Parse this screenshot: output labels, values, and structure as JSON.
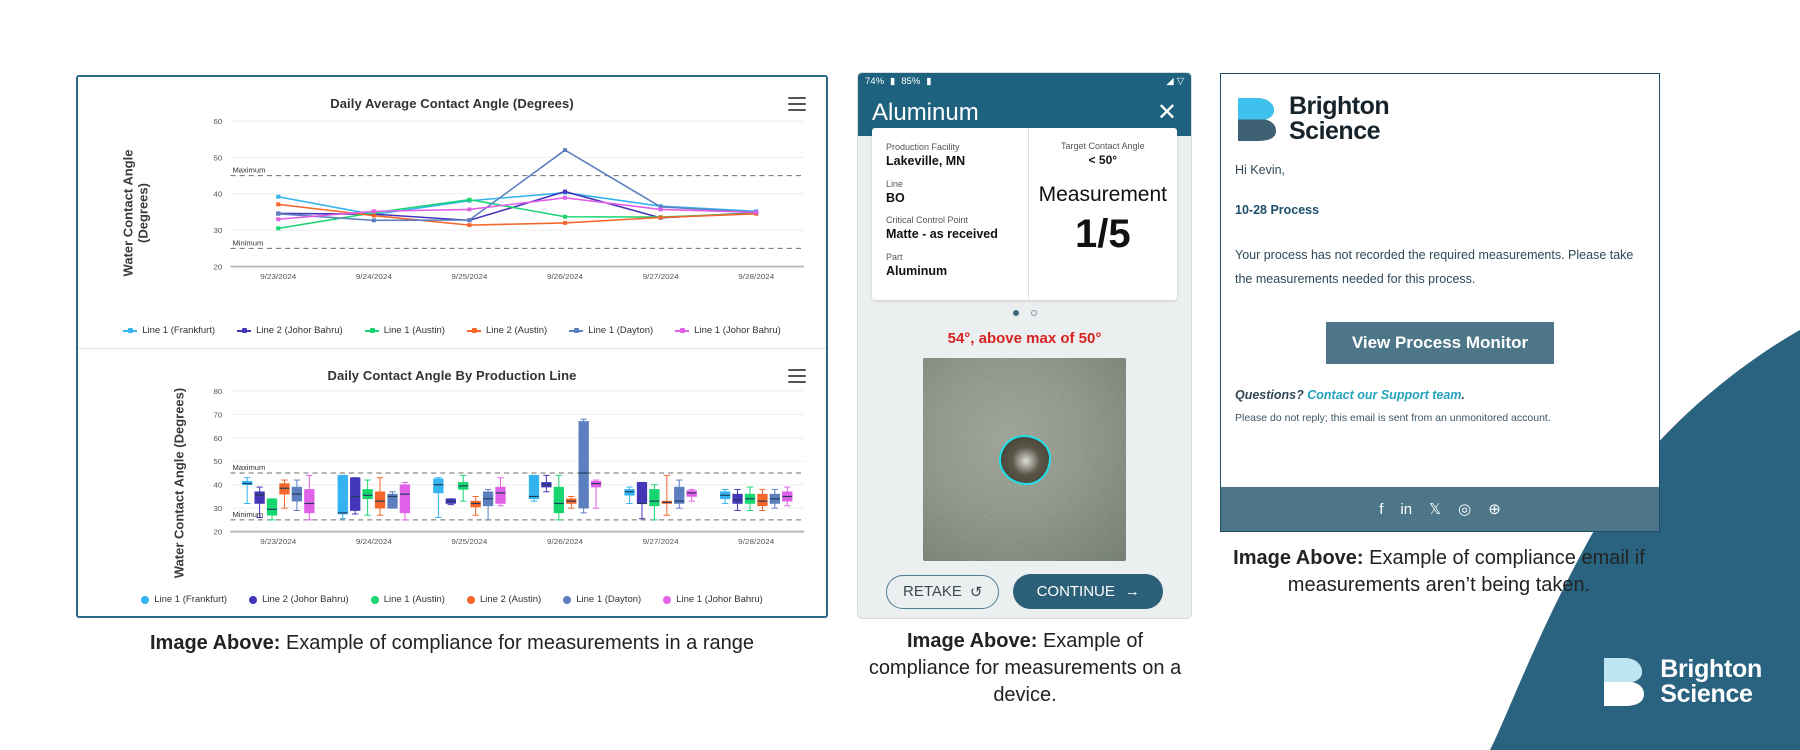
{
  "captions": {
    "left_bold": "Image Above:",
    "left_text": " Example of compliance for measurements in a range",
    "mid_bold": "Image Above:",
    "mid_text": " Example of compliance for measurements on a device.",
    "right_bold": "Image Above:",
    "right_text": " Example of compliance email if measurements aren’t being taken."
  },
  "brand": {
    "line1": "Brighton",
    "line2": "Science"
  },
  "chart_data": [
    {
      "type": "line",
      "title": "Daily Average Contact Angle (Degrees)",
      "xlabel": "",
      "ylabel": "Water Contact Angle\n(Degrees)",
      "ylabel_l1": "Water Contact Angle",
      "ylabel_l2": "(Degrees)",
      "ylim": [
        20,
        60
      ],
      "yticks": [
        20,
        30,
        40,
        50,
        60
      ],
      "categories": [
        "9/23/2024",
        "9/24/2024",
        "9/25/2024",
        "9/26/2024",
        "9/27/2024",
        "9/28/2024"
      ],
      "limits": [
        {
          "label": "Maximum",
          "value": 45
        },
        {
          "label": "Minimum",
          "value": 25
        }
      ],
      "grid": true,
      "legend_position": "bottom",
      "series": [
        {
          "name": "Line 1 (Frankfurt)",
          "color": "#33b4ef",
          "values": [
            39.2,
            34.3,
            38.1,
            40.3,
            36.6,
            35.2
          ]
        },
        {
          "name": "Line 2 (Johor Bahru)",
          "color": "#4436b8",
          "values": [
            34.6,
            34.4,
            32.7,
            40.6,
            33.4,
            34.8
          ]
        },
        {
          "name": "Line 1 (Austin)",
          "color": "#18d66f",
          "values": [
            30.5,
            34.8,
            38.4,
            33.7,
            33.6,
            34.6
          ]
        },
        {
          "name": "Line 2 (Austin)",
          "color": "#f4662a",
          "values": [
            37.1,
            34.0,
            31.4,
            32.0,
            33.5,
            34.5
          ]
        },
        {
          "name": "Line 1 (Dayton)",
          "color": "#5c7fc0",
          "values": [
            34.5,
            32.7,
            32.8,
            52.0,
            36.4,
            34.9
          ]
        },
        {
          "name": "Line 1 (Johor Bahru)",
          "color": "#e060e8",
          "values": [
            33.0,
            35.2,
            35.7,
            38.9,
            35.7,
            34.9
          ]
        }
      ]
    },
    {
      "type": "box",
      "title": "Daily Contact Angle By Production Line",
      "xlabel": "",
      "ylabel": "Water Contact Angle (Degrees)",
      "ylim": [
        20,
        80
      ],
      "yticks": [
        20,
        30,
        40,
        50,
        60,
        70,
        80
      ],
      "categories": [
        "9/23/2024",
        "9/24/2024",
        "9/25/2024",
        "9/26/2024",
        "9/27/2024",
        "9/28/2024"
      ],
      "limits": [
        {
          "label": "Maximum",
          "value": 45
        },
        {
          "label": "Minimum",
          "value": 25
        }
      ],
      "grid": true,
      "legend_position": "bottom",
      "series": [
        {
          "name": "Line 1 (Frankfurt)",
          "color": "#33b4ef",
          "boxes": [
            {
              "low": 32,
              "q1": 40,
              "med": 40.5,
              "q3": 41.5,
              "high": 43
            },
            {
              "low": 25.5,
              "q1": 27.5,
              "med": 28,
              "q3": 44,
              "high": 44
            },
            {
              "low": 26,
              "q1": 36.5,
              "med": 40,
              "q3": 42.5,
              "high": 43
            },
            {
              "low": 33,
              "q1": 34,
              "med": 35,
              "q3": 44,
              "high": 44
            },
            {
              "low": 32,
              "q1": 35.5,
              "med": 37,
              "q3": 38,
              "high": 39
            },
            {
              "low": 32,
              "q1": 34,
              "med": 35.5,
              "q3": 37,
              "high": 38
            }
          ]
        },
        {
          "name": "Line 2 (Johor Bahru)",
          "color": "#4436b8",
          "boxes": [
            {
              "low": 26,
              "q1": 32,
              "med": 35.5,
              "q3": 37,
              "high": 39
            },
            {
              "low": 27.5,
              "q1": 29,
              "med": 35,
              "q3": 43,
              "high": 43
            },
            {
              "low": 31.5,
              "q1": 32,
              "med": 33,
              "q3": 34,
              "high": 34
            },
            {
              "low": 37,
              "q1": 39,
              "med": 40,
              "q3": 41,
              "high": 44
            },
            {
              "low": 25.5,
              "q1": 32,
              "med": 32,
              "q3": 41,
              "high": 41
            },
            {
              "low": 29,
              "q1": 32,
              "med": 33.5,
              "q3": 36,
              "high": 38
            }
          ]
        },
        {
          "name": "Line 1 (Austin)",
          "color": "#18d66f",
          "boxes": [
            {
              "low": 25,
              "q1": 27,
              "med": 29.5,
              "q3": 34,
              "high": 34
            },
            {
              "low": 27,
              "q1": 34,
              "med": 35.5,
              "q3": 38,
              "high": 42
            },
            {
              "low": 33,
              "q1": 38,
              "med": 39.5,
              "q3": 41,
              "high": 44
            },
            {
              "low": 25,
              "q1": 28,
              "med": 32,
              "q3": 39,
              "high": 44
            },
            {
              "low": 25,
              "q1": 31,
              "med": 33,
              "q3": 38,
              "high": 40
            },
            {
              "low": 29,
              "q1": 32,
              "med": 34,
              "q3": 36,
              "high": 39
            }
          ]
        },
        {
          "name": "Line 2 (Austin)",
          "color": "#f4662a",
          "boxes": [
            {
              "low": 30,
              "q1": 36,
              "med": 38.5,
              "q3": 40.5,
              "high": 42
            },
            {
              "low": 27,
              "q1": 30,
              "med": 33,
              "q3": 37,
              "high": 43
            },
            {
              "low": 27,
              "q1": 30.5,
              "med": 32,
              "q3": 33,
              "high": 35
            },
            {
              "low": 30,
              "q1": 32,
              "med": 33,
              "q3": 34,
              "high": 35
            },
            {
              "low": 27,
              "q1": 32,
              "med": 32.5,
              "q3": 33,
              "high": 44
            },
            {
              "low": 29,
              "q1": 31,
              "med": 33,
              "q3": 36,
              "high": 38
            }
          ]
        },
        {
          "name": "Line 1 (Dayton)",
          "color": "#5c7fc0",
          "boxes": [
            {
              "low": 29,
              "q1": 33,
              "med": 36,
              "q3": 39,
              "high": 42
            },
            {
              "low": 30,
              "q1": 30,
              "med": 35,
              "q3": 36,
              "high": 37
            },
            {
              "low": 25,
              "q1": 31,
              "med": 34,
              "q3": 37,
              "high": 38
            },
            {
              "low": 28,
              "q1": 30,
              "med": 45,
              "q3": 67,
              "high": 68
            },
            {
              "low": 30,
              "q1": 32,
              "med": 33,
              "q3": 39,
              "high": 42
            },
            {
              "low": 30,
              "q1": 32,
              "med": 34,
              "q3": 36,
              "high": 38
            }
          ]
        },
        {
          "name": "Line 1 (Johor Bahru)",
          "color": "#e060e8",
          "boxes": [
            {
              "low": 25,
              "q1": 28,
              "med": 32,
              "q3": 38,
              "high": 44
            },
            {
              "low": 25,
              "q1": 28,
              "med": 36,
              "q3": 40,
              "high": 41
            },
            {
              "low": 31,
              "q1": 32,
              "med": 36.5,
              "q3": 39,
              "high": 43
            },
            {
              "low": 30,
              "q1": 39,
              "med": 40.5,
              "q3": 41.5,
              "high": 42
            },
            {
              "low": 33,
              "q1": 35,
              "med": 36.5,
              "q3": 37.5,
              "high": 38
            },
            {
              "low": 31,
              "q1": 33,
              "med": 35,
              "q3": 37,
              "high": 39
            }
          ]
        }
      ]
    }
  ],
  "phone": {
    "status_left_1": "74%",
    "status_left_2": "85%",
    "app_title": "Aluminum",
    "close_icon": "✕",
    "info": {
      "facility_label": "Production Facility",
      "facility_value": "Lakeville, MN",
      "line_label": "Line",
      "line_value": "BO",
      "ccp_label": "Critical Control Point",
      "ccp_value": "Matte - as received",
      "part_label": "Part",
      "part_value": "Aluminum",
      "target_label": "Target Contact Angle",
      "target_value": "< 50°",
      "measurement_word": "Measurement",
      "measurement_count": "1/5"
    },
    "alert": "54°, above max of 50°",
    "retake_label": "RETAKE",
    "retake_icon": "↺",
    "continue_label": "CONTINUE",
    "continue_icon": "→",
    "alert_color": "#d7231f"
  },
  "email": {
    "greeting": "Hi Kevin,",
    "process": "10-28 Process",
    "paragraph": "Your process has not recorded the required measurements. Please take the measurements needed for this process.",
    "cta_label": "View Process Monitor",
    "questions_prefix": "Questions? ",
    "questions_link": "Contact our Support team",
    "questions_suffix": ".",
    "disclaimer": "Please do not reply; this email is sent from an unmonitored account.",
    "social": [
      "f",
      "in",
      "𝕏",
      "◎",
      "⊕"
    ],
    "accent": "#4e7689",
    "link_color": "#23a3bd"
  }
}
